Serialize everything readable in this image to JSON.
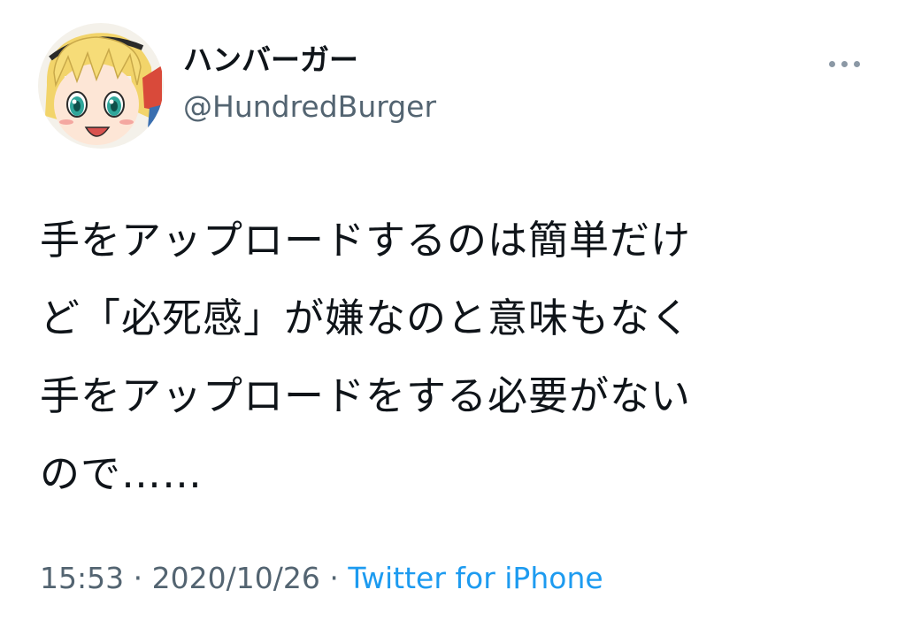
{
  "author": {
    "display_name": "ハンバーガー",
    "handle": "@HundredBurger"
  },
  "tweet": {
    "lines": [
      "手をアップロードするのは簡単だけ",
      "ど「必死感」が嫌なのと意味もなく",
      "手をアップロードをする必要がない",
      "ので……"
    ]
  },
  "meta": {
    "time": "15:53",
    "separator": "·",
    "date": "2020/10/26",
    "source": "Twitter for iPhone"
  },
  "icons": {
    "more": "more-horizontal-icon",
    "avatar": "anime-character-avatar"
  },
  "colors": {
    "text": "#0f1419",
    "secondary": "#536471",
    "link": "#1d9bf0"
  }
}
